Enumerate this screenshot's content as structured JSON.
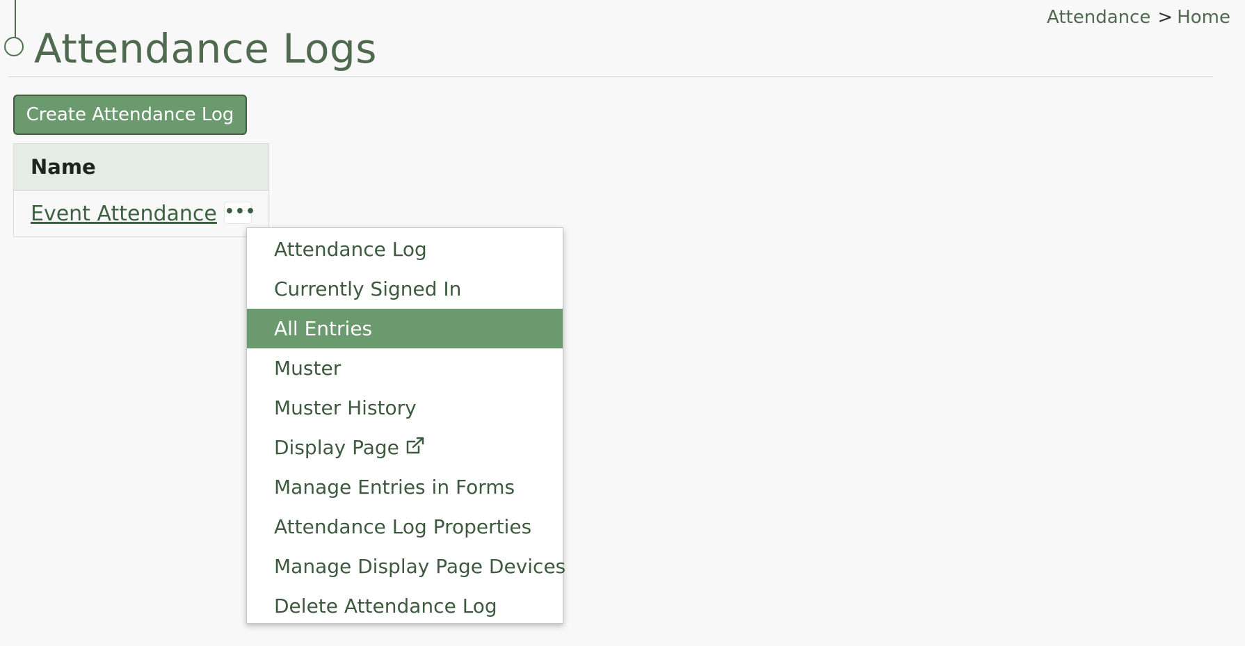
{
  "header": {
    "title": "Attendance Logs"
  },
  "breadcrumb": {
    "items": [
      "Attendance",
      "Home"
    ],
    "separator": ">"
  },
  "toolbar": {
    "create_label": "Create Attendance Log"
  },
  "table": {
    "columns": [
      "Name"
    ],
    "rows": [
      {
        "name": "Event Attendance",
        "menu_icon": "ellipsis-icon"
      }
    ]
  },
  "dropdown": {
    "items": [
      {
        "label": "Attendance Log"
      },
      {
        "label": "Currently Signed In"
      },
      {
        "label": "All Entries",
        "active": true
      },
      {
        "label": "Muster"
      },
      {
        "label": "Muster History"
      },
      {
        "label": "Display Page",
        "icon": "external-link-icon"
      },
      {
        "label": "Manage Entries in Forms"
      },
      {
        "label": "Attendance Log Properties"
      },
      {
        "label": "Manage Display Page Devices"
      },
      {
        "label": "Delete Attendance Log"
      }
    ]
  },
  "colors": {
    "primary": "#6c9a6f",
    "text": "#4f6a4f",
    "background": "#f8f8f8"
  }
}
